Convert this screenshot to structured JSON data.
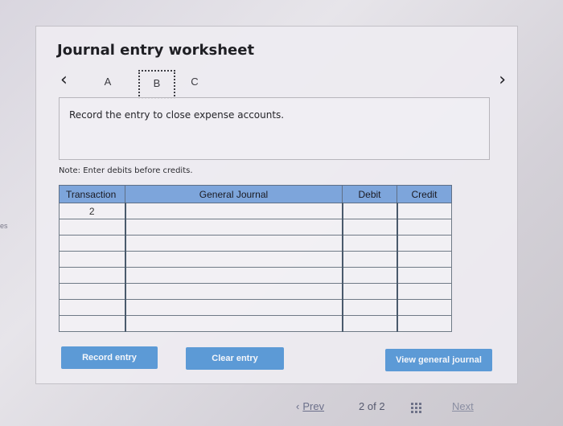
{
  "background": {
    "side_fragment": "es"
  },
  "worksheet": {
    "title": "Journal entry worksheet",
    "tabs": [
      "A",
      "B",
      "C"
    ],
    "active_tab": "B",
    "nav_prev_icon": "chevron-left-icon",
    "nav_next_icon": "chevron-right-icon",
    "instruction": "Record the entry to close expense accounts.",
    "note": "Note: Enter debits before credits."
  },
  "journal_table": {
    "headers": {
      "transaction": "Transaction",
      "general_journal": "General Journal",
      "debit": "Debit",
      "credit": "Credit"
    },
    "rows": [
      {
        "transaction": "2",
        "account": "",
        "debit": "",
        "credit": ""
      },
      {
        "transaction": "",
        "account": "",
        "debit": "",
        "credit": ""
      },
      {
        "transaction": "",
        "account": "",
        "debit": "",
        "credit": ""
      },
      {
        "transaction": "",
        "account": "",
        "debit": "",
        "credit": ""
      },
      {
        "transaction": "",
        "account": "",
        "debit": "",
        "credit": ""
      },
      {
        "transaction": "",
        "account": "",
        "debit": "",
        "credit": ""
      },
      {
        "transaction": "",
        "account": "",
        "debit": "",
        "credit": ""
      },
      {
        "transaction": "",
        "account": "",
        "debit": "",
        "credit": ""
      }
    ]
  },
  "buttons": {
    "record": "Record entry",
    "clear": "Clear entry",
    "view": "View general journal"
  },
  "pagination": {
    "prev_icon": "chevron-left-icon",
    "prev_label": "Prev",
    "page_current": "2",
    "page_text": "of",
    "page_total": "2",
    "grid_icon": "grid-icon",
    "next_label": "Next"
  },
  "colors": {
    "header_blue": "#7da5db",
    "button_blue": "#5c9ad6"
  }
}
